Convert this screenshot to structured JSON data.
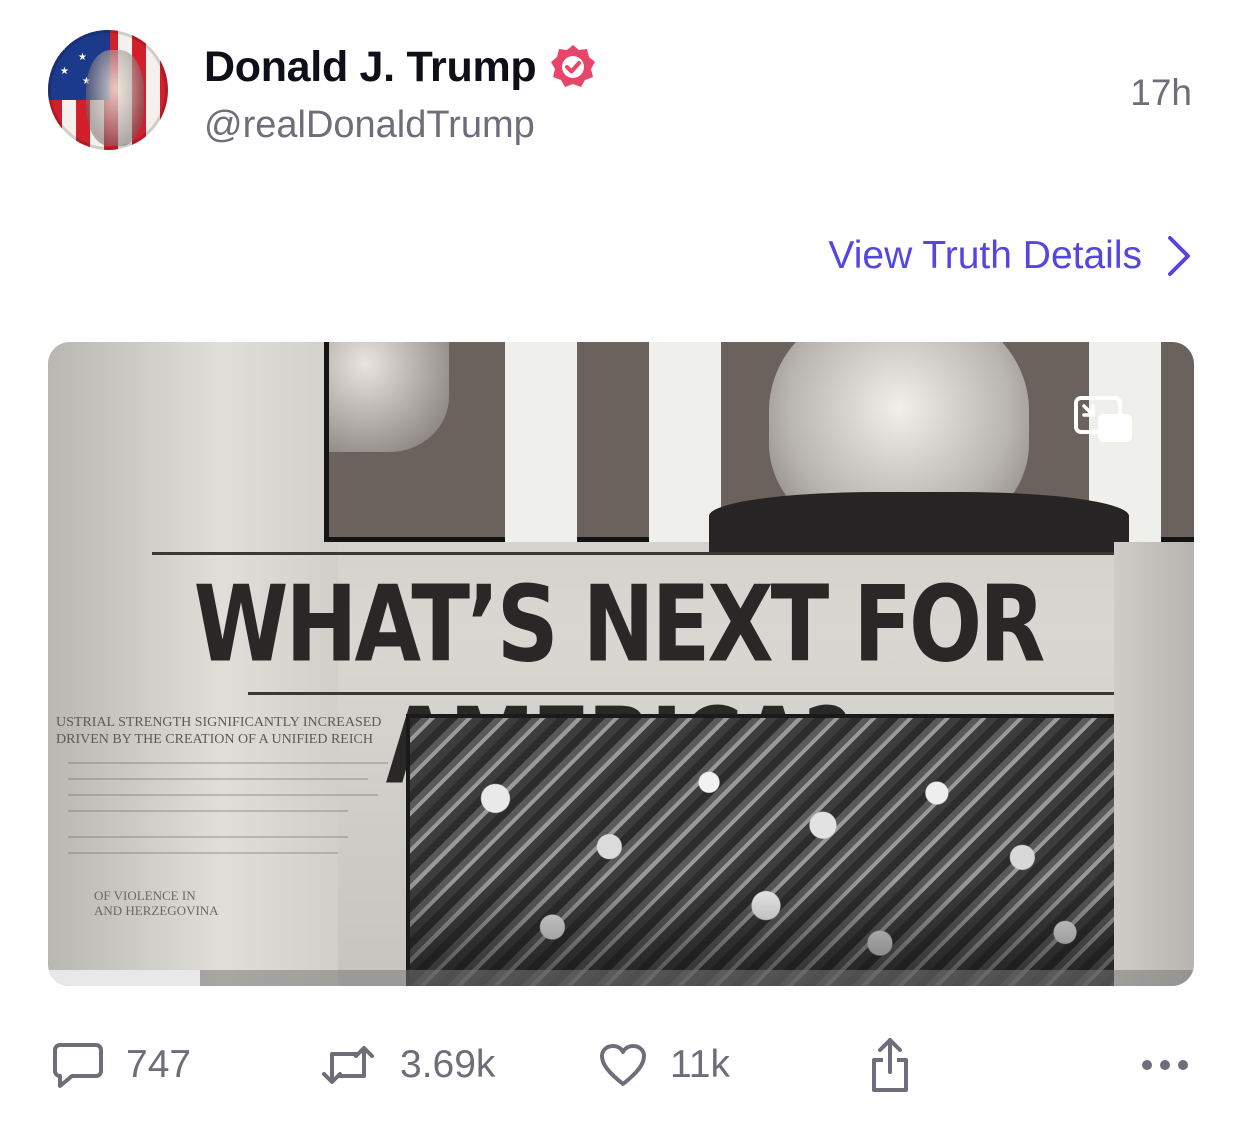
{
  "author": {
    "display_name": "Donald J. Trump",
    "handle": "@realDonaldTrump",
    "verified": true,
    "avatar_icon": "avatar-image"
  },
  "post": {
    "time_ago": "17h",
    "details_link_label": "View Truth Details"
  },
  "media": {
    "headline": "WHAT’S NEXT FOR AMERICA?",
    "caption_line_1": "USTRIAL STRENGTH SIGNIFICANTLY INCREASED",
    "caption_line_2": "DRIVEN BY THE CREATION OF A UNIFIED REICH",
    "caption_line_3": "OF VIOLENCE IN",
    "caption_line_4": "AND HERZEGOVINA",
    "progress_fraction": 0.133,
    "pip_icon": "picture-in-picture-icon"
  },
  "actions": {
    "replies": "747",
    "retruths": "3.69k",
    "likes": "11k"
  },
  "colors": {
    "accent": "#5446e0",
    "verified_badge": "#e8456a",
    "muted_text": "#6e6e7a"
  }
}
